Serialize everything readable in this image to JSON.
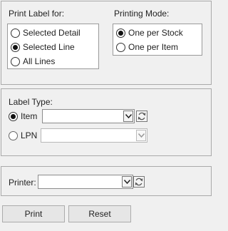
{
  "print_label_for": {
    "title": "Print Label for:",
    "options": [
      {
        "label": "Selected Detail",
        "checked": false
      },
      {
        "label": "Selected Line",
        "checked": true
      },
      {
        "label": "All Lines",
        "checked": false
      }
    ]
  },
  "printing_mode": {
    "title": "Printing Mode:",
    "options": [
      {
        "label": "One per Stock",
        "checked": true
      },
      {
        "label": "One per Item",
        "checked": false
      }
    ]
  },
  "label_type": {
    "title": "Label Type:",
    "item_label": "Item",
    "lpn_label": "LPN",
    "item_value": "",
    "lpn_value": ""
  },
  "printer": {
    "label": "Printer:",
    "value": ""
  },
  "buttons": {
    "print": "Print",
    "reset": "Reset"
  },
  "icons": {
    "dropdown": "chevron-down-icon",
    "refresh": "refresh-icon"
  }
}
